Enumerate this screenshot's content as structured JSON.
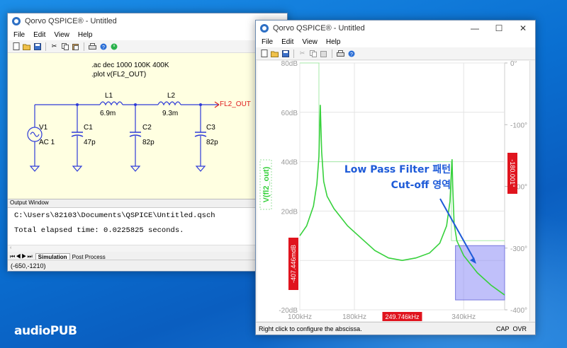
{
  "win1": {
    "title": "Qorvo QSPICE® - Untitled",
    "menu": [
      "File",
      "Edit",
      "View",
      "Help"
    ],
    "schematic": {
      "directive1": ".ac dec 1000 100K 400K",
      "directive2": ".plot v(FL2_OUT)",
      "source_name": "V1",
      "source_value": "AC 1",
      "L1_name": "L1",
      "L1_value": "6.9m",
      "L2_name": "L2",
      "L2_value": "9.3m",
      "C1_name": "C1",
      "C1_value": "47p",
      "C2_name": "C2",
      "C2_value": "82p",
      "C3_name": "C3",
      "C3_value": "82p",
      "net_label": "FL2_OUT"
    },
    "output": {
      "header": "Output Window",
      "line1": "C:\\Users\\82103\\Documents\\QSPICE\\Untitled.qsch",
      "line2": "Total elapsed time: 0.0225825 seconds.",
      "tabs": [
        "Simulation",
        "Post Process"
      ]
    },
    "status": "(-650,-1210)"
  },
  "win2": {
    "title": "Qorvo QSPICE® - Untitled",
    "menu": [
      "File",
      "Edit",
      "View",
      "Help"
    ],
    "status_left": "Right click to configure the abscissa.",
    "status_caps": "CAP",
    "status_ovr": "OVR"
  },
  "annotation": {
    "line1": "Low Pass Filter 패턴",
    "line2": "Cut-off 영역"
  },
  "logo": "audioPUB",
  "colors": {
    "trace": "#37d13c",
    "marker_bg": "#e0141e",
    "annotation_text": "#1e5bd8",
    "selection": "#8c8cf5"
  },
  "chart_data": {
    "type": "line",
    "title": "",
    "series": [
      {
        "name": "V(fl2_out)",
        "x": [
          100,
          110,
          120,
          125,
          128,
          130,
          132,
          135,
          140,
          150,
          170,
          190,
          210,
          230,
          250,
          270,
          290,
          305,
          315,
          320,
          322,
          323,
          324,
          326,
          330,
          340,
          360,
          380,
          400
        ],
        "y": [
          10,
          14,
          22,
          31,
          42,
          63,
          44,
          32,
          26,
          21,
          14,
          9,
          4,
          1,
          0,
          1,
          3,
          7,
          14,
          24,
          36,
          41,
          30,
          15,
          8,
          2,
          -5,
          -10,
          -14
        ]
      }
    ],
    "x_unit": "kHz",
    "xlim": [
      100,
      400
    ],
    "ylim": [
      -20,
      80
    ],
    "y2lim": [
      -400,
      0
    ],
    "yticks": [
      "80dB",
      "60dB",
      "40dB",
      "20dB",
      "0",
      "-20dB"
    ],
    "xticks": [
      "100kHz",
      "180kHz",
      "340kHz"
    ],
    "y2ticks": [
      "0°",
      "-100°",
      "-200°",
      "-300°",
      "-400°"
    ],
    "ylabel": "V(fl2_out)",
    "cursor_x_label": "249.746kHz",
    "cursor_y_label": "-407.446mdB",
    "cursor_phase_label": "-180.001°",
    "grid": true
  }
}
